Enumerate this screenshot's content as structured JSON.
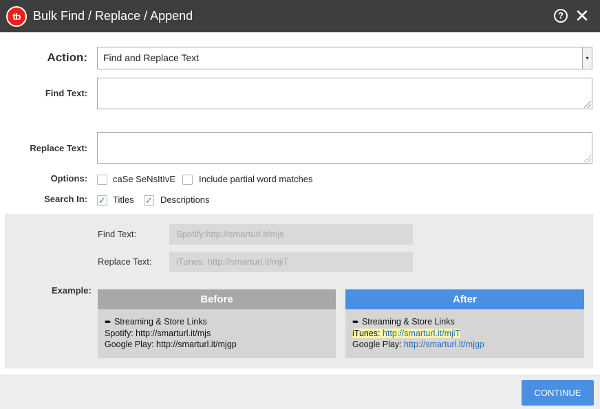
{
  "header": {
    "logo_text": "tb",
    "title": "Bulk Find / Replace / Append",
    "help_glyph": "?",
    "close_glyph": "✕"
  },
  "form": {
    "action_label": "Action:",
    "action_value": "Find and Replace Text",
    "find_label": "Find Text:",
    "find_value": "",
    "replace_label": "Replace Text:",
    "replace_value": "",
    "options_label": "Options:",
    "options": [
      {
        "label": "caSe SeNsItIvE",
        "checked": false
      },
      {
        "label": "Include partial word matches",
        "checked": false
      }
    ],
    "search_in_label": "Search In:",
    "search_in": [
      {
        "label": "Titles",
        "checked": true
      },
      {
        "label": "Descriptions",
        "checked": true
      }
    ]
  },
  "example": {
    "find_label": "Find Text:",
    "find_value": "Spotify:http://smarturl.it/mjs",
    "replace_label": "Replace Text:",
    "replace_value": "iTunes: http://smarturl.it/mjiT",
    "example_label": "Example:",
    "before": {
      "header": "Before",
      "line1": "➨ Streaming & Store Links",
      "line2": "Spotify: http://smarturl.it/mjs",
      "line3": "Google Play: http://smarturl.it/mjgp"
    },
    "after": {
      "header": "After",
      "line1": "➨ Streaming & Store Links",
      "line2_prefix": "iTunes: ",
      "line2_link": "http://smarturl.it/mjiT",
      "line3_prefix": "Google Play: ",
      "line3_link": "http://smarturl.it/mjgp"
    }
  },
  "footer": {
    "continue_label": "CONTINUE"
  },
  "colors": {
    "titlebar": "#3e3e3e",
    "brand_red": "#e62117",
    "accent_blue": "#4a90e2",
    "before_header": "#a8a8a8",
    "link": "#1f6fbf",
    "highlight": "#fbf6a4"
  }
}
